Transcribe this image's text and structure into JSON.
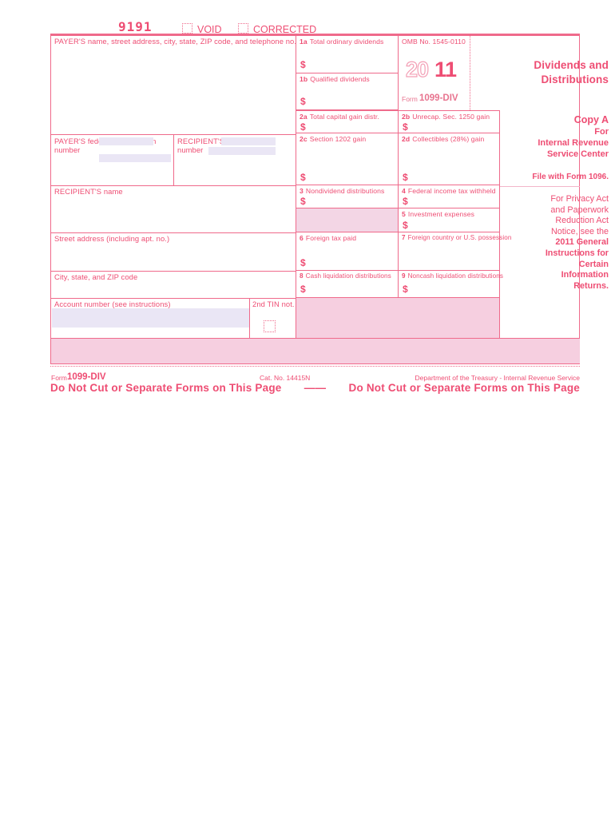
{
  "document": {
    "form_number_ocr": "9191",
    "void_label": "VOID",
    "corrected_label": "CORRECTED",
    "title_line1": "Dividends and",
    "title_line2": "Distributions",
    "omb": "OMB No. 1545-0110",
    "year_outline": "20",
    "year_solid": "11",
    "form_prefix": "Form",
    "form_name": "1099-DIV"
  },
  "payer": {
    "name_address_label": "PAYER'S name, street address, city, state, ZIP code, and telephone no.",
    "fed_id_line1": "PAYER'S federal identification",
    "fed_id_line2": "number"
  },
  "recipient": {
    "id_line1": "RECIPIENT'S identification",
    "id_line2": "number",
    "name_label": "RECIPIENT'S name",
    "street_label": "Street address (including apt. no.)",
    "city_label": "City, state, and ZIP code",
    "account_label": "Account number (see instructions)",
    "tin_label": "2nd TIN not."
  },
  "boxes": {
    "b1a": {
      "num": "1a",
      "label": "Total ordinary dividends",
      "amount_symbol": "$"
    },
    "b1b": {
      "num": "1b",
      "label": "Qualified dividends",
      "amount_symbol": "$"
    },
    "b2a": {
      "num": "2a",
      "label": "Total capital gain distr.",
      "amount_symbol": "$"
    },
    "b2b": {
      "num": "2b",
      "label": "Unrecap. Sec. 1250 gain",
      "amount_symbol": "$"
    },
    "b2c": {
      "num": "2c",
      "label": "Section 1202 gain",
      "amount_symbol": "$"
    },
    "b2d": {
      "num": "2d",
      "label": "Collectibles (28%) gain",
      "amount_symbol": "$"
    },
    "b3": {
      "num": "3",
      "label": "Nondividend distributions",
      "amount_symbol": "$"
    },
    "b4": {
      "num": "4",
      "label": "Federal income tax withheld",
      "amount_symbol": "$"
    },
    "b5": {
      "num": "5",
      "label": "Investment expenses",
      "amount_symbol": "$"
    },
    "b6": {
      "num": "6",
      "label": "Foreign tax paid",
      "amount_symbol": "$"
    },
    "b7": {
      "num": "7",
      "label": "Foreign country or U.S. possession"
    },
    "b8": {
      "num": "8",
      "label": "Cash liquidation distributions",
      "amount_symbol": "$"
    },
    "b9": {
      "num": "9",
      "label": "Noncash liquidation distributions",
      "amount_symbol": "$"
    }
  },
  "copy": {
    "copy_a": "Copy A",
    "for": "For",
    "irs_line1": "Internal Revenue",
    "irs_line2": "Service Center",
    "file_with": "File with Form 1096.",
    "privacy_1": "For Privacy Act",
    "privacy_2": "and Paperwork",
    "privacy_3": "Reduction Act",
    "privacy_4": "Notice, see the",
    "privacy_5": "2011 General",
    "privacy_6": "Instructions for",
    "privacy_7": "Certain",
    "privacy_8": "Information",
    "privacy_9": "Returns."
  },
  "footer": {
    "form_prefix": "Form",
    "form_name": "1099-DIV",
    "cat_no": "Cat. No. 14415N",
    "department": "Department of the Treasury - Internal Revenue Service",
    "dnc_left": "Do Not Cut or Separate Forms on This Page",
    "dnc_dash": "——",
    "dnc_right": "Do Not Cut or Separate Forms on This Page"
  },
  "colors": {
    "rule": "#ef6a8b",
    "text": "#ee4d73",
    "fill_pink": "#f6cfe0",
    "lavender": "#eae6f5"
  }
}
